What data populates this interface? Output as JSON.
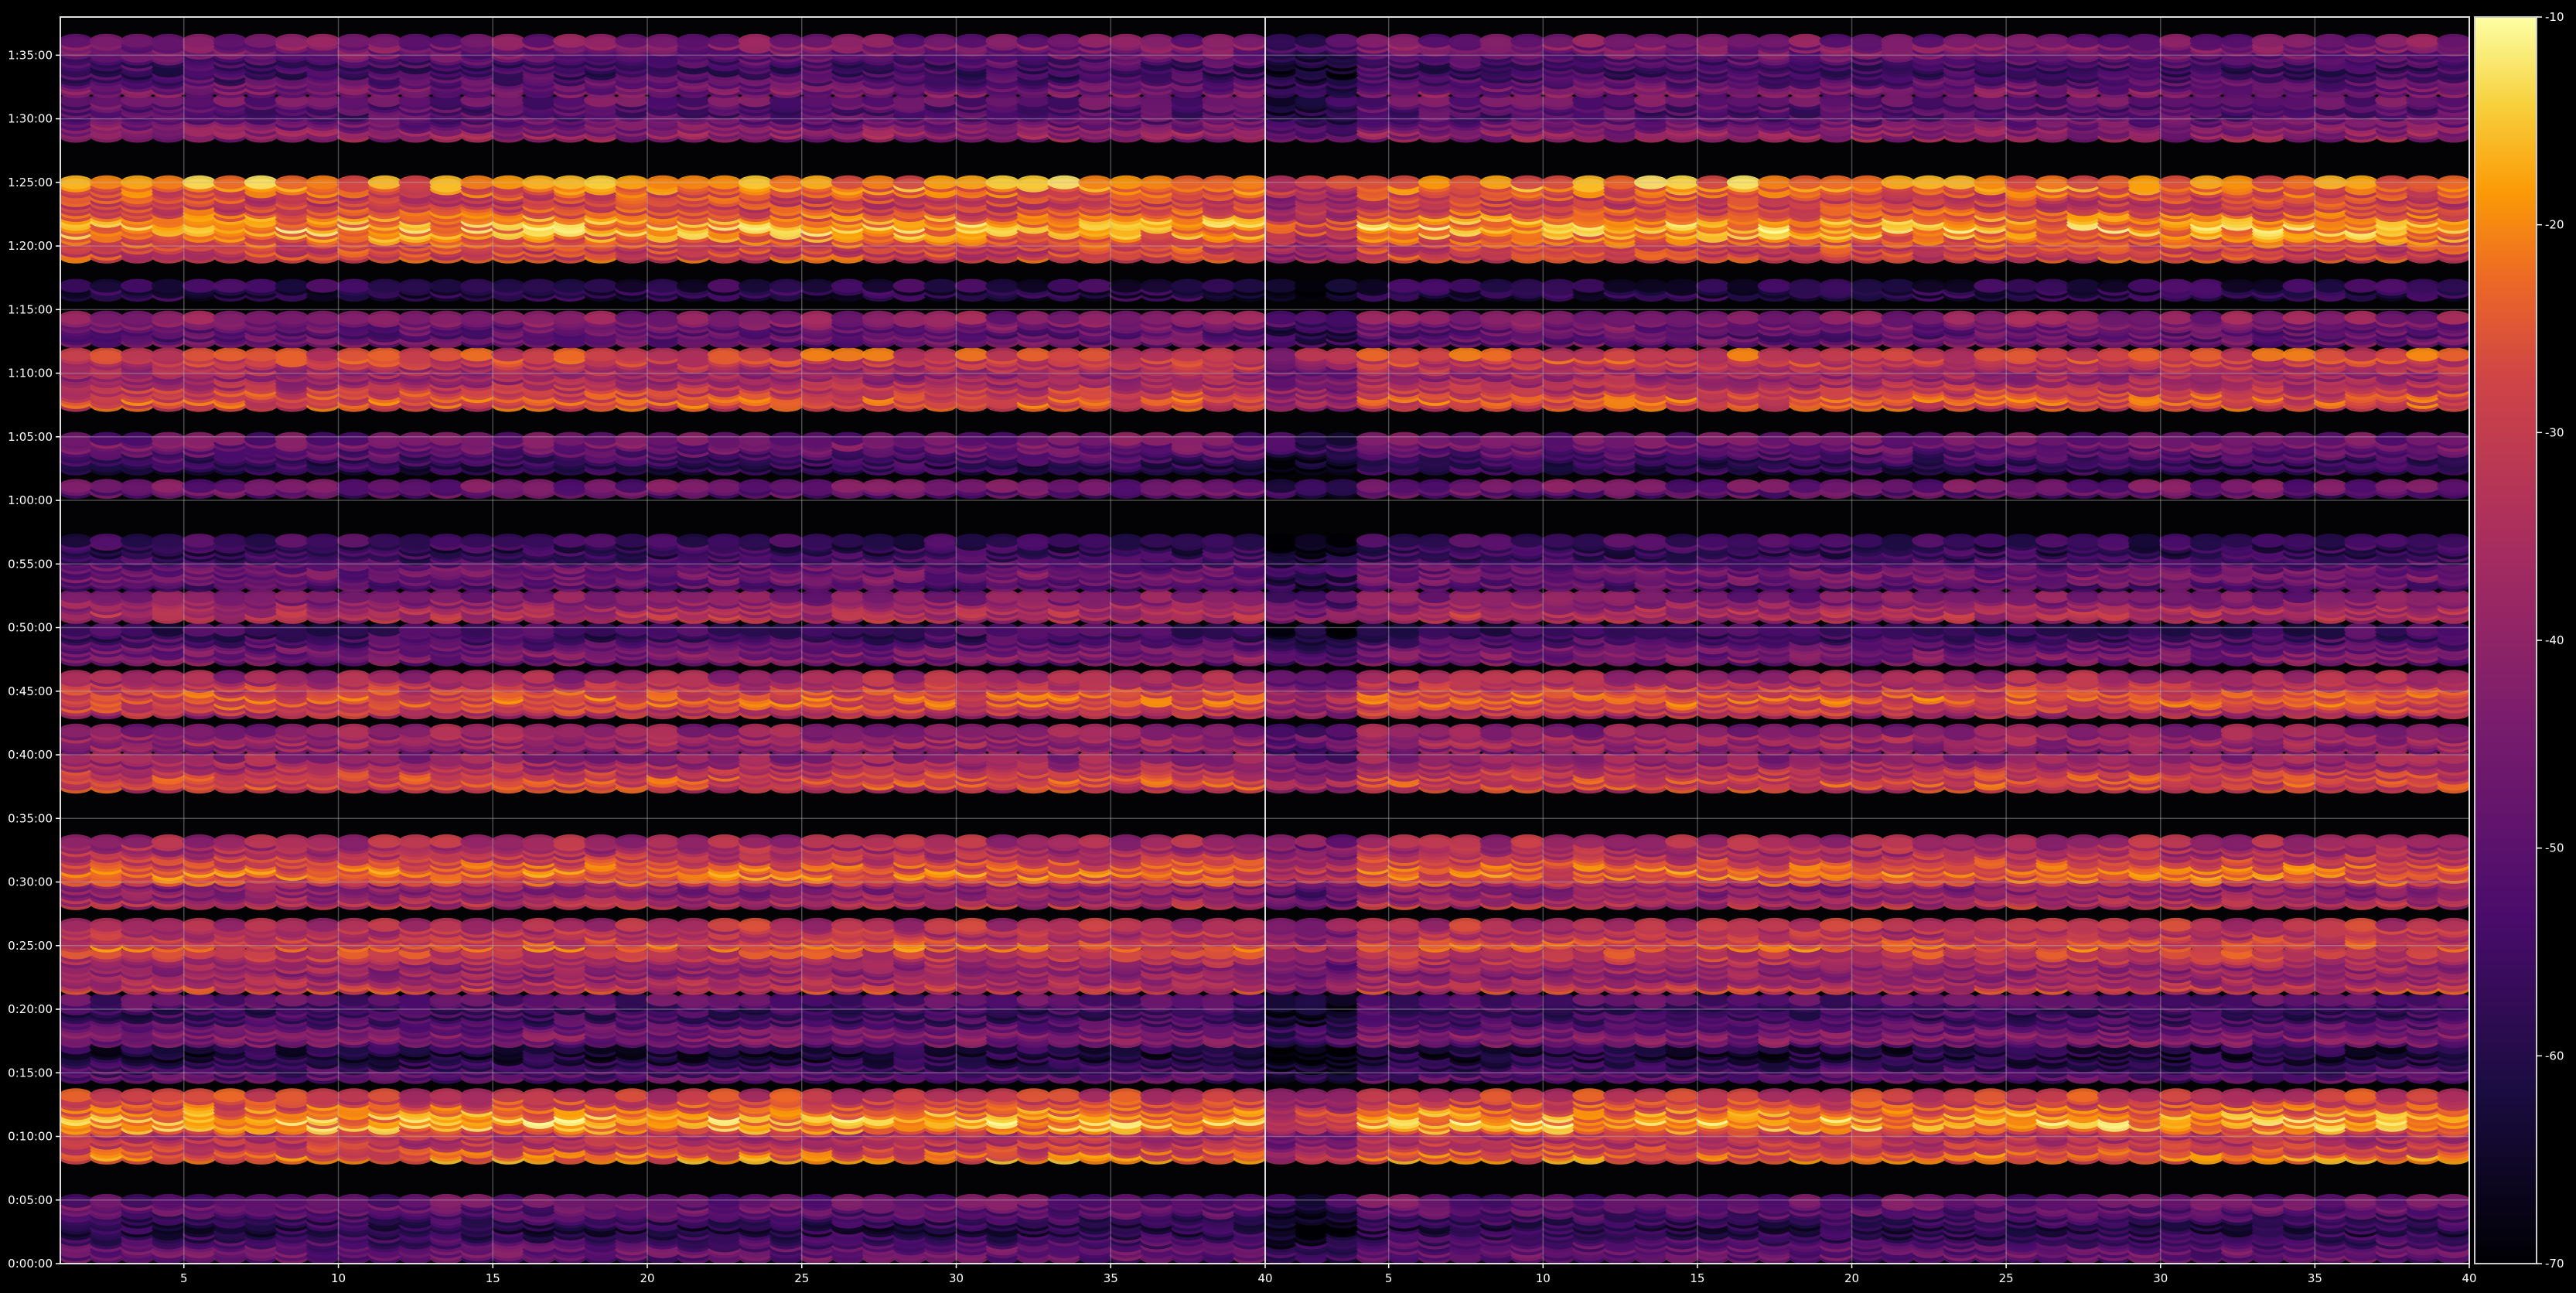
{
  "chart_data": {
    "type": "heatmap",
    "title": "",
    "xlabel": "",
    "ylabel": "",
    "panels": [
      {
        "name": "left",
        "xlim": [
          1,
          40
        ],
        "xticks": [
          5,
          10,
          15,
          20,
          25,
          30,
          35,
          40
        ]
      },
      {
        "name": "right",
        "xlim": [
          1,
          40
        ],
        "xticks": [
          5,
          10,
          15,
          20,
          25,
          30,
          35,
          40
        ]
      }
    ],
    "y_axis": {
      "unit": "seconds",
      "lim": [
        0,
        5880
      ],
      "ticks": [
        0,
        300,
        600,
        900,
        1200,
        1500,
        1800,
        2100,
        2400,
        2700,
        3000,
        3300,
        3600,
        3900,
        4200,
        4500,
        4800,
        5100,
        5400,
        5700
      ],
      "tick_labels": [
        "0:00:00",
        "0:05:00",
        "0:10:00",
        "0:15:00",
        "0:20:00",
        "0:25:00",
        "0:30:00",
        "0:35:00",
        "0:40:00",
        "0:45:00",
        "0:50:00",
        "0:55:00",
        "1:00:00",
        "1:05:00",
        "1:10:00",
        "1:15:00",
        "1:20:00",
        "1:25:00",
        "1:30:00",
        "1:35:00"
      ]
    },
    "colorbar": {
      "colormap": "inferno",
      "lim": [
        -70,
        -10
      ],
      "ticks": [
        -70,
        -60,
        -50,
        -40,
        -30,
        -20,
        -10
      ],
      "tick_labels": [
        "-70",
        "-60",
        "-50",
        "-40",
        "-30",
        "-20",
        "-10"
      ]
    },
    "bands": [
      {
        "t0": 30,
        "t1": 300,
        "level": -54
      },
      {
        "t0": 500,
        "t1": 640,
        "level": -28
      },
      {
        "t0": 640,
        "t1": 800,
        "level": -24
      },
      {
        "t0": 880,
        "t1": 1020,
        "level": -56
      },
      {
        "t0": 1050,
        "t1": 1250,
        "level": -50
      },
      {
        "t0": 1300,
        "t1": 1480,
        "level": -34
      },
      {
        "t0": 1500,
        "t1": 1610,
        "level": -28
      },
      {
        "t0": 1700,
        "t1": 1810,
        "level": -36
      },
      {
        "t0": 1810,
        "t1": 2000,
        "level": -30
      },
      {
        "t0": 2250,
        "t1": 2400,
        "level": -34
      },
      {
        "t0": 2430,
        "t1": 2520,
        "level": -44
      },
      {
        "t0": 2600,
        "t1": 2780,
        "level": -32
      },
      {
        "t0": 2850,
        "t1": 3000,
        "level": -50
      },
      {
        "t0": 3050,
        "t1": 3150,
        "level": -40
      },
      {
        "t0": 3200,
        "t1": 3420,
        "level": -52
      },
      {
        "t0": 3640,
        "t1": 3680,
        "level": -52
      },
      {
        "t0": 3750,
        "t1": 3900,
        "level": -52
      },
      {
        "t0": 4050,
        "t1": 4300,
        "level": -32
      },
      {
        "t0": 4350,
        "t1": 4470,
        "level": -44
      },
      {
        "t0": 4570,
        "t1": 4620,
        "level": -54
      },
      {
        "t0": 4750,
        "t1": 5100,
        "level": -24
      },
      {
        "t0": 5320,
        "t1": 5500,
        "level": -46
      },
      {
        "t0": 5530,
        "t1": 5780,
        "level": -50
      }
    ]
  }
}
